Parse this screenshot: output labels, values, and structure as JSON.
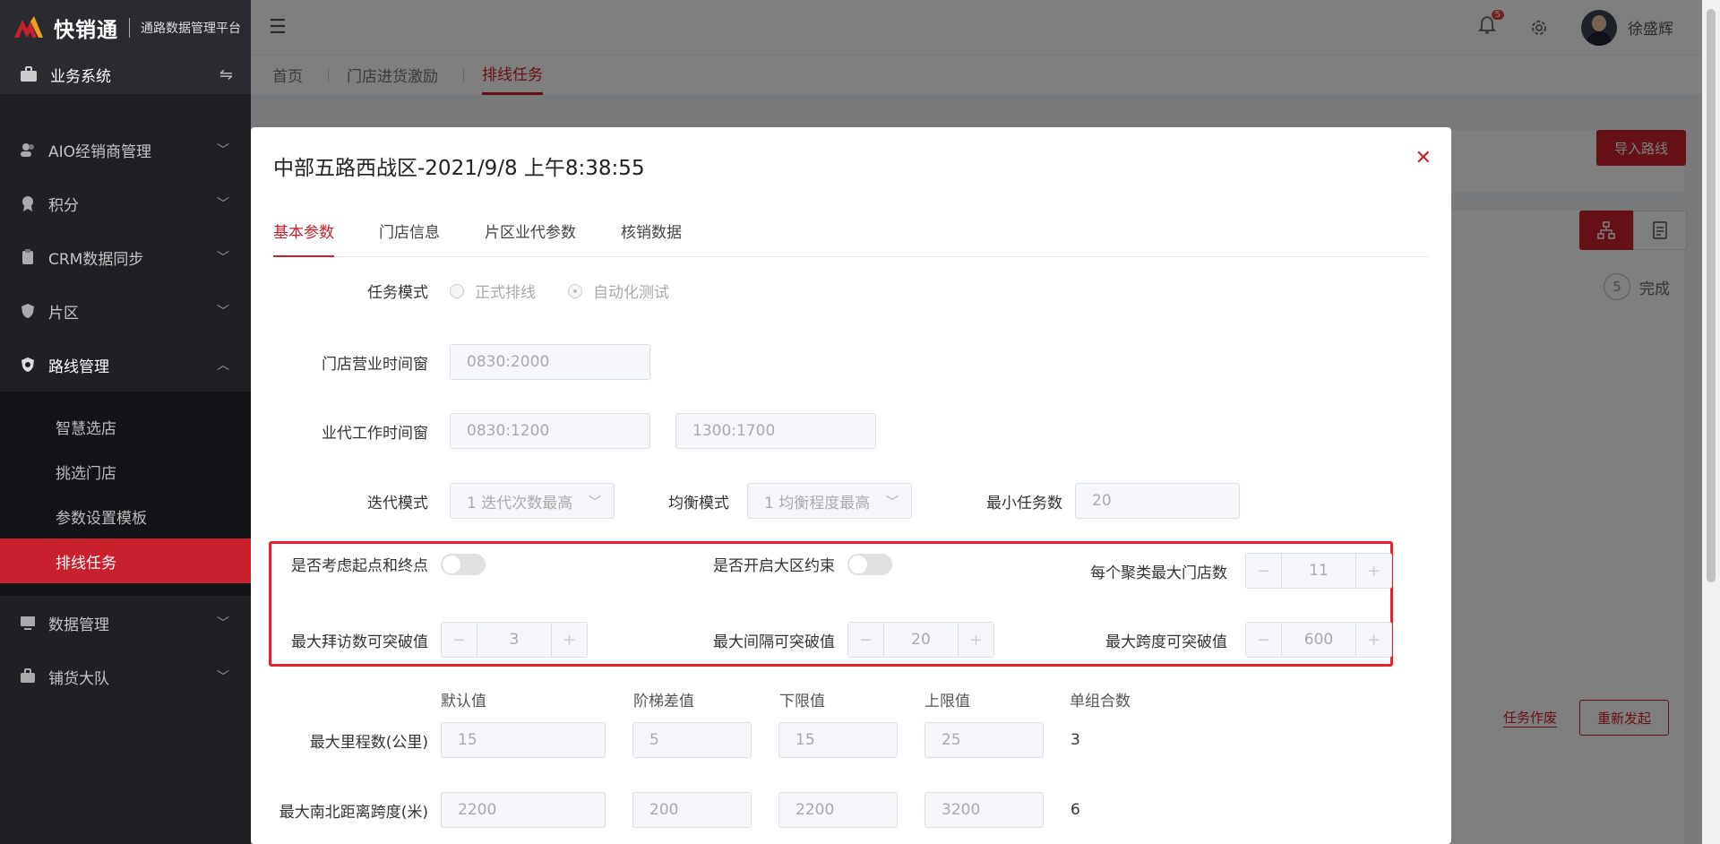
{
  "app": {
    "logo_title": "快销通",
    "logo_sub": "通路数据管理平台"
  },
  "system": {
    "label": "业务系统"
  },
  "sidebar": {
    "items": [
      {
        "label": "AIO经销商管理"
      },
      {
        "label": "积分"
      },
      {
        "label": "CRM数据同步"
      },
      {
        "label": "片区"
      },
      {
        "label": "路线管理"
      },
      {
        "label": "数据管理"
      },
      {
        "label": "铺货大队"
      }
    ],
    "sub_items": [
      {
        "label": "智慧选店"
      },
      {
        "label": "挑选门店"
      },
      {
        "label": "参数设置模板"
      },
      {
        "label": "排线任务"
      }
    ]
  },
  "header": {
    "notification_count": "5",
    "user_name": "徐盛辉"
  },
  "tabs": [
    {
      "label": "首页"
    },
    {
      "label": "门店进货激励"
    },
    {
      "label": "排线任务"
    }
  ],
  "background": {
    "import_button": "导入路线",
    "step_number": "5",
    "step_label": "完成",
    "void_link": "任务作废",
    "relaunch_button": "重新发起"
  },
  "modal": {
    "title": "中部五路西战区-2021/9/8 上午8:38:55",
    "tabs": [
      {
        "label": "基本参数"
      },
      {
        "label": "门店信息"
      },
      {
        "label": "片区业代参数"
      },
      {
        "label": "核销数据"
      }
    ],
    "task_mode": {
      "label": "任务模式",
      "option_formal": "正式排线",
      "option_auto": "自动化测试",
      "selected": "自动化测试"
    },
    "store_window": {
      "label": "门店营业时间窗",
      "value": "0830:2000"
    },
    "agent_window": {
      "label": "业代工作时间窗",
      "value1": "0830:1200",
      "value2": "1300:1700"
    },
    "iter_mode": {
      "label": "迭代模式",
      "value": "1 迭代次数最高"
    },
    "balance_mode": {
      "label": "均衡模式",
      "value": "1 均衡程度最高"
    },
    "min_tasks": {
      "label": "最小任务数",
      "value": "20"
    },
    "consider_endpoints": {
      "label": "是否考虑起点和终点",
      "on": false
    },
    "region_constraint": {
      "label": "是否开启大区约束",
      "on": false
    },
    "max_stores_cluster": {
      "label": "每个聚类最大门店数",
      "value": "11"
    },
    "max_visits_break": {
      "label": "最大拜访数可突破值",
      "value": "3"
    },
    "max_interval_break": {
      "label": "最大间隔可突破值",
      "value": "20"
    },
    "max_span_break": {
      "label": "最大跨度可突破值",
      "value": "600"
    },
    "columns": [
      "默认值",
      "阶梯差值",
      "下限值",
      "上限值",
      "单组合数"
    ],
    "rows": [
      {
        "label": "最大里程数(公里)",
        "values": [
          "15",
          "5",
          "15",
          "25"
        ],
        "combos": "3"
      },
      {
        "label": "最大南北距离跨度(米)",
        "values": [
          "2200",
          "200",
          "2200",
          "3200"
        ],
        "combos": "6"
      }
    ]
  },
  "colors": {
    "accent": "#c8202c",
    "highlight_box": "#e8202c",
    "sidebar_bg": "#1f2024"
  }
}
